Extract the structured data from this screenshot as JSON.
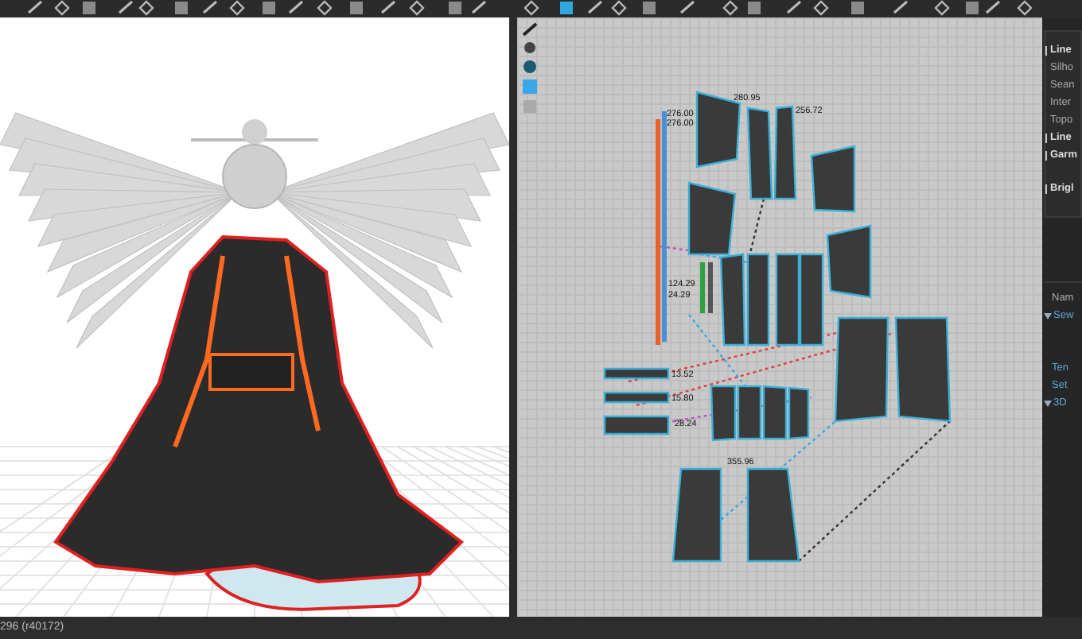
{
  "pattern_window": {
    "measurements": [
      "276.00",
      "276.00",
      "280.95",
      "256.72",
      "124.29",
      "24.29",
      "13.52",
      "15.80",
      "28.24",
      "355.96"
    ]
  },
  "property_editor": {
    "display_items": [
      {
        "label": "Line",
        "kind": "header"
      },
      {
        "label": "Silho",
        "kind": "item"
      },
      {
        "label": "Sean",
        "kind": "item"
      },
      {
        "label": "Inter",
        "kind": "item"
      },
      {
        "label": "Topo",
        "kind": "item"
      },
      {
        "label": "Line",
        "kind": "header"
      },
      {
        "label": "Garm",
        "kind": "header"
      },
      {
        "label": "Brigl",
        "kind": "header"
      }
    ],
    "property_items": [
      {
        "label": "Nam",
        "kind": "field"
      },
      {
        "label": "Sew",
        "kind": "group"
      },
      {
        "label": "Ten",
        "kind": "link"
      },
      {
        "label": "Set",
        "kind": "link"
      },
      {
        "label": "3D",
        "kind": "group"
      }
    ]
  },
  "status_bar": {
    "text": "296 (r40172)"
  }
}
